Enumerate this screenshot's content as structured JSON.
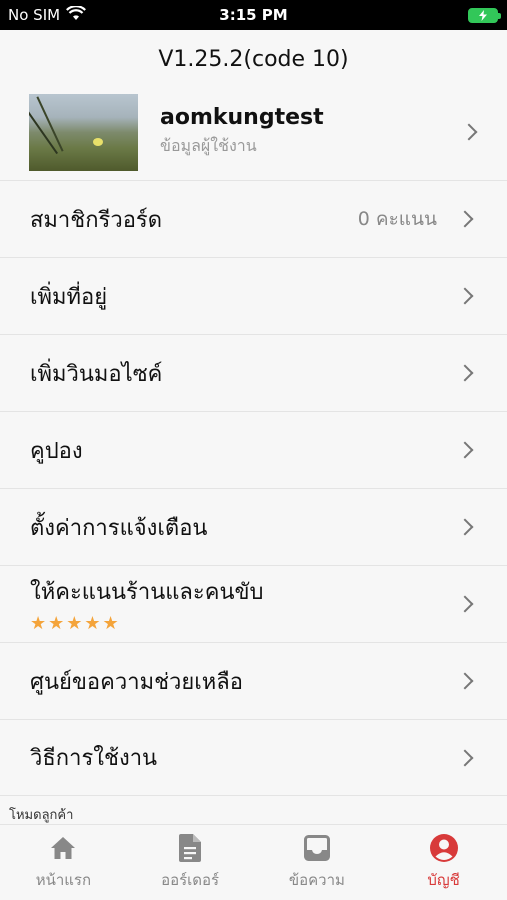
{
  "status_bar": {
    "carrier": "No SIM",
    "time": "3:15 PM"
  },
  "version": "V1.25.2(code 10)",
  "profile": {
    "name": "aomkungtest",
    "subtitle": "ข้อมูลผู้ใช้งาน"
  },
  "menu": {
    "member_reward": {
      "label": "สมาชิกรีวอร์ด",
      "value": "0 คะแนน"
    },
    "add_address": {
      "label": "เพิ่มที่อยู่"
    },
    "add_bike": {
      "label": "เพิ่มวินมอไซค์"
    },
    "coupon": {
      "label": "คูปอง"
    },
    "notifications": {
      "label": "ตั้งค่าการแจ้งเตือน"
    },
    "rate": {
      "label": "ให้คะแนนร้านและคนขับ",
      "stars": "★★★★★",
      "rating": 5
    },
    "help": {
      "label": "ศูนย์ขอความช่วยเหลือ"
    },
    "how_to": {
      "label": "วิธีการใช้งาน"
    }
  },
  "mode_label": "โหมดลูกค้า",
  "tabs": [
    {
      "label": "หน้าแรก",
      "icon": "home-icon",
      "active": false
    },
    {
      "label": "ออร์เดอร์",
      "icon": "document-icon",
      "active": false
    },
    {
      "label": "ข้อความ",
      "icon": "inbox-icon",
      "active": false
    },
    {
      "label": "บัญชี",
      "icon": "account-icon",
      "active": true
    }
  ],
  "colors": {
    "accent": "#d83a3a",
    "star": "#f4a43b",
    "battery": "#32c759"
  }
}
